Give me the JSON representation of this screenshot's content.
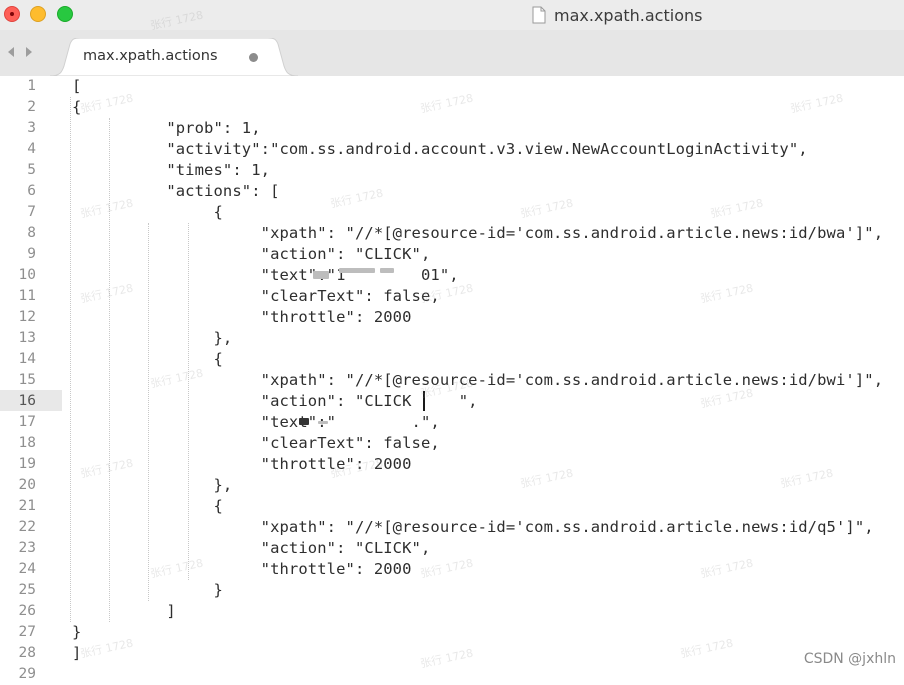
{
  "window": {
    "title": "max.xpath.actions"
  },
  "tab": {
    "label": "max.xpath.actions",
    "unsaved_indicator": "modified-dot"
  },
  "editor": {
    "current_line": 16,
    "line_numbers": [
      "1",
      "2",
      "3",
      "4",
      "5",
      "6",
      "7",
      "8",
      "9",
      "10",
      "11",
      "12",
      "13",
      "14",
      "15",
      "16",
      "17",
      "18",
      "19",
      "20",
      "21",
      "22",
      "23",
      "24",
      "25",
      "26",
      "27",
      "28",
      "29"
    ],
    "lines": [
      "[",
      "{",
      "          \"prob\": 1,",
      "          \"activity\":\"com.ss.android.account.v3.view.NewAccountLoginActivity\",",
      "          \"times\": 1,",
      "          \"actions\": [",
      "               {",
      "                    \"xpath\": \"//*[@resource-id='com.ss.android.article.news:id/bwa']\",",
      "                    \"action\": \"CLICK\",",
      "                    \"text\":\"1        01\",",
      "                    \"clearText\": false,",
      "                    \"throttle\": 2000",
      "               },",
      "               {",
      "                    \"xpath\": \"//*[@resource-id='com.ss.android.article.news:id/bwi']\",",
      "                    \"action\": \"CLICK     \",",
      "                    \"text\":\"        .\",",
      "                    \"clearText\": false,",
      "                    \"throttle\": 2000",
      "               },",
      "               {",
      "                    \"xpath\": \"//*[@resource-id='com.ss.android.article.news:id/q5']\",",
      "                    \"action\": \"CLICK\",",
      "                    \"throttle\": 2000",
      "               }",
      "          ]",
      "}",
      "]",
      ""
    ]
  },
  "watermark_text": "张行 1728",
  "footer": {
    "credit": "CSDN @jxhln"
  }
}
